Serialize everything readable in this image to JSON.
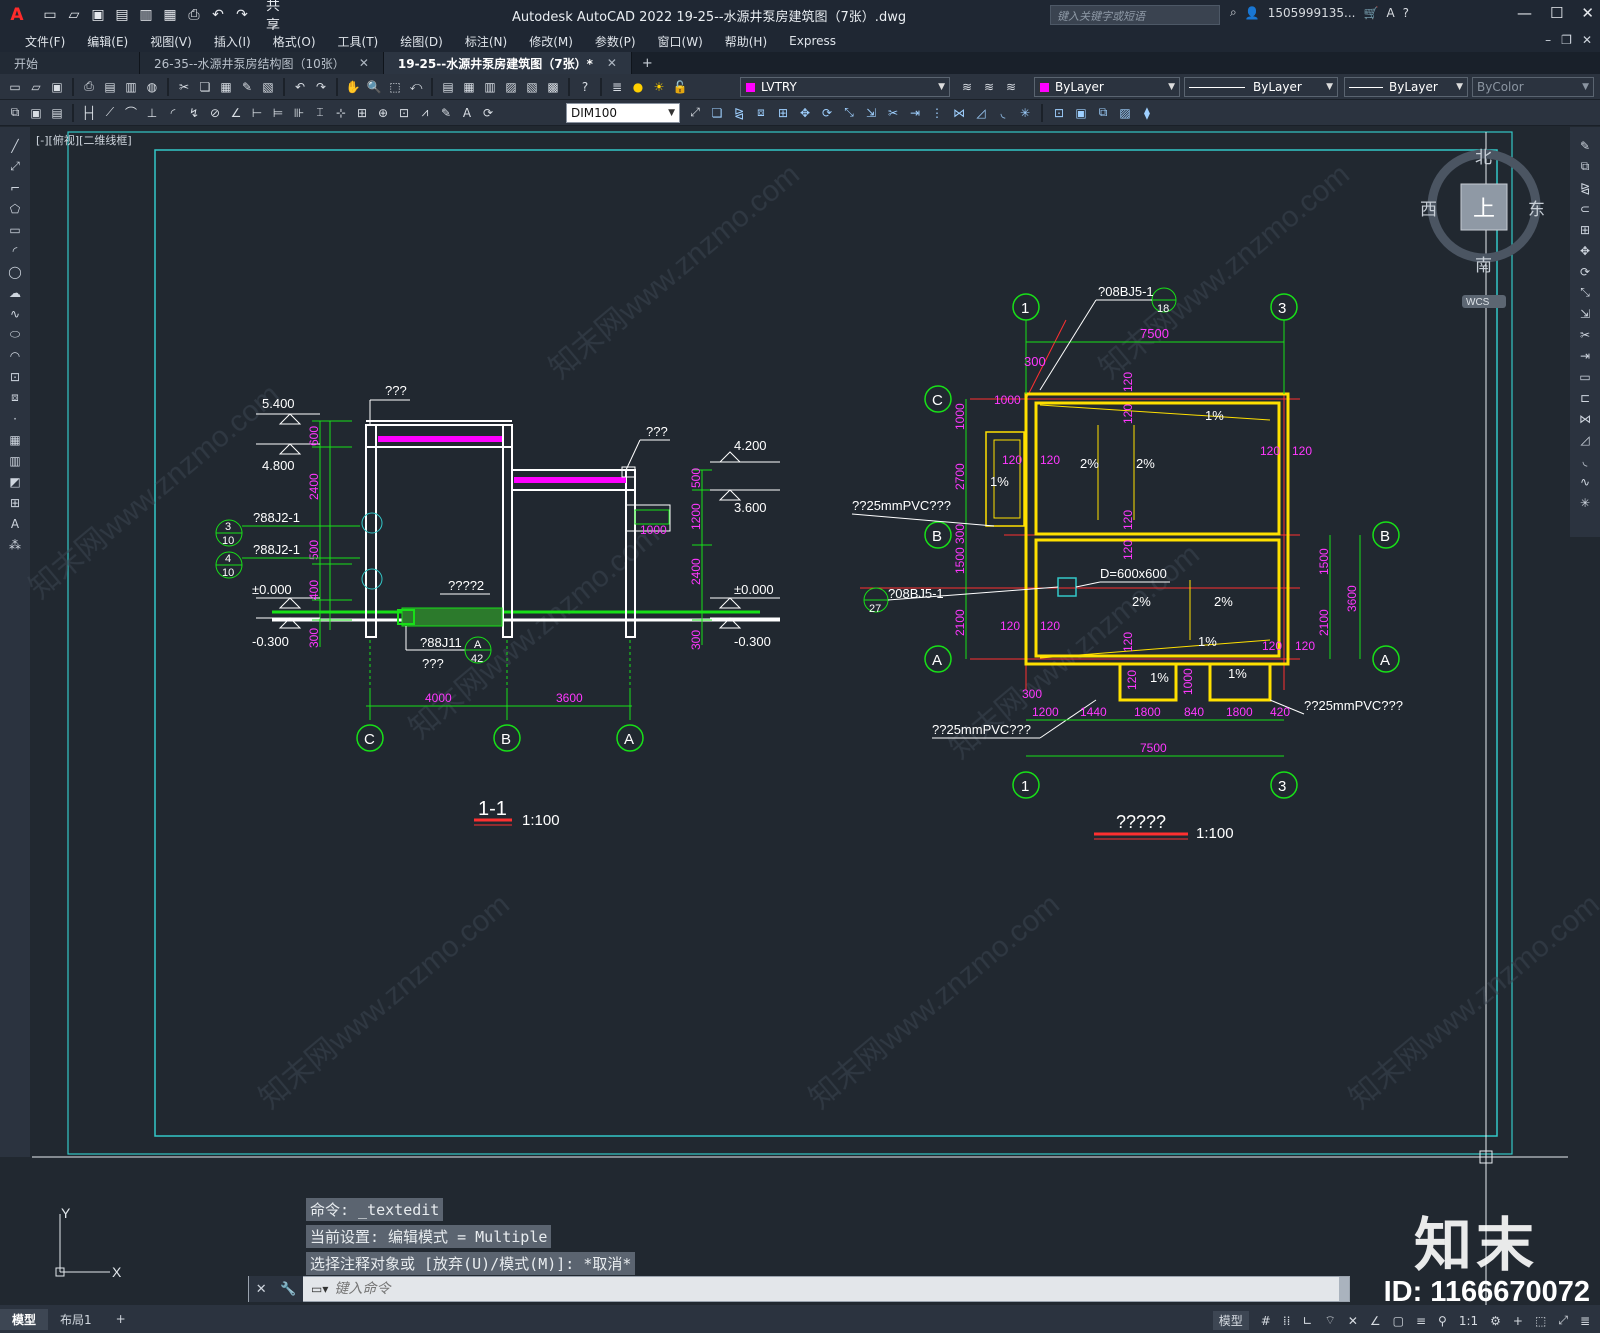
{
  "app": {
    "logo": "A",
    "title": "Autodesk AutoCAD 2022    19-25--水源井泵房建筑图（7张）.dwg",
    "share_label": "共享",
    "search_placeholder": "键入关键字或短语",
    "user": "1505999135...",
    "quick_icons": [
      "new-icon",
      "open-icon",
      "save-icon",
      "saveas-icon",
      "plot-icon",
      "publish-icon",
      "print-icon",
      "undo-icon",
      "redo-icon"
    ]
  },
  "menu": [
    "文件(F)",
    "编辑(E)",
    "视图(V)",
    "插入(I)",
    "格式(O)",
    "工具(T)",
    "绘图(D)",
    "标注(N)",
    "修改(M)",
    "参数(P)",
    "窗口(W)",
    "帮助(H)",
    "Express"
  ],
  "tabs": [
    {
      "label": "开始",
      "closable": false,
      "active": false
    },
    {
      "label": "26-35--水源井泵房结构图（10张）",
      "closable": true,
      "active": false
    },
    {
      "label": "19-25--水源井泵房建筑图（7张）*",
      "closable": true,
      "active": true
    }
  ],
  "toolbar": {
    "layer": "LVTRY",
    "color": "ByLayer",
    "linetype": "ByLayer",
    "lineweight": "ByLayer",
    "plotstyle": "ByColor",
    "dimstyle": "DIM100",
    "layer_color": "#ff00ff"
  },
  "viewport_label": "[-][俯视][二维线框]",
  "viewcube": {
    "north": "北",
    "south": "南",
    "east": "东",
    "west": "西",
    "top": "上",
    "wcs": "WCS"
  },
  "section": {
    "elevations_left": [
      "5.400",
      "4.800",
      "±0.000",
      "-0.300"
    ],
    "elevations_right": [
      "4.200",
      "3.600",
      "±0.000",
      "-0.300"
    ],
    "refs": [
      {
        "top": "3",
        "bottom": "10",
        "text": "?88J2-1"
      },
      {
        "top": "4",
        "bottom": "10",
        "text": "?88J2-1"
      }
    ],
    "dims_vertical_left": [
      "600",
      "2400",
      "500",
      "400",
      "300"
    ],
    "dims_vertical_right": [
      "500",
      "1200",
      "2400",
      "300"
    ],
    "dim_1000": "1000",
    "top_labels": [
      "???",
      "???"
    ],
    "floor_label": "????2",
    "detail_ref": {
      "text": "?88J11",
      "sub": "???",
      "top": "A",
      "bottom": "42"
    },
    "spans": [
      "4000",
      "3600"
    ],
    "axes": [
      "C",
      "B",
      "A"
    ],
    "title": "1-1",
    "scale": "1:100"
  },
  "plan": {
    "axes_top": [
      "1",
      "3"
    ],
    "axes_side": [
      "C",
      "B",
      "A"
    ],
    "ref_top": {
      "text": "?08BJ5-1",
      "number": "18"
    },
    "ref_left": {
      "text": "?08BJ5-1",
      "number": "27"
    },
    "dim_total": "7500",
    "dims_left": [
      "1000",
      "2700",
      "300",
      "1500",
      "2100"
    ],
    "dims_right": [
      "1500",
      "2100",
      "3600"
    ],
    "dim_300": "300",
    "wall_thickness": "120",
    "slopes": [
      "1%",
      "2%",
      "2%",
      "1%",
      "2%",
      "2%",
      "1%",
      "1%",
      "1%"
    ],
    "drain_label": "D=600x600",
    "pvc_label": "??25mmPVC???",
    "dims_bottom": [
      "1200",
      "1440",
      "1800",
      "840",
      "1800",
      "420"
    ],
    "pit_dims": [
      "120",
      "1000"
    ],
    "title": "?????",
    "scale": "1:100"
  },
  "command_history": [
    "命令: _textedit",
    "当前设置: 编辑模式 = Multiple",
    "选择注释对象或 [放弃(U)/模式(M)]: *取消*"
  ],
  "command_placeholder": "键入命令",
  "layout_tabs": [
    "模型",
    "布局1"
  ],
  "status": {
    "model": "模型",
    "scale": "1:1"
  },
  "watermark": {
    "brand": "知末",
    "id": "ID: 1166670072",
    "site": "知末网www.znzmo.com"
  }
}
